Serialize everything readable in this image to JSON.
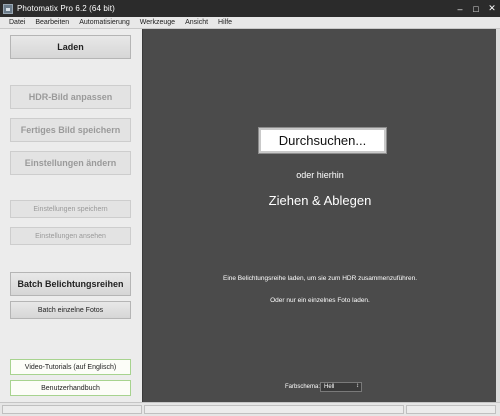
{
  "window": {
    "title": "Photomatix Pro 6.2 (64 bit)",
    "minimize": "–",
    "maximize": "□",
    "close": "✕"
  },
  "menu": [
    "Datei",
    "Bearbeiten",
    "Automatisierung",
    "Werkzeuge",
    "Ansicht",
    "Hilfe"
  ],
  "sidebar": {
    "load": "Laden",
    "hdr_adjust": "HDR-Bild anpassen",
    "save_final": "Fertiges Bild speichern",
    "change_settings": "Einstellungen ändern",
    "save_settings": "Einstellungen speichern",
    "view_settings": "Einstellungen ansehen",
    "batch_bracketed": "Batch Belichtungsreihen",
    "batch_single": "Batch einzelne Fotos",
    "video_tutorials": "Video-Tutorials (auf Englisch)",
    "user_manual": "Benutzerhandbuch"
  },
  "main": {
    "browse": "Durchsuchen...",
    "or_here": "oder hierhin",
    "drag_drop": "Ziehen & Ablegen",
    "info_load_series": "Eine Belichtungsreihe laden, um sie zum HDR zusammenzuführen.",
    "info_single_photo": "Oder nur ein einzelnes Foto laden.",
    "color_scheme_label": "Farbschema:",
    "color_scheme_value": "Hell"
  }
}
